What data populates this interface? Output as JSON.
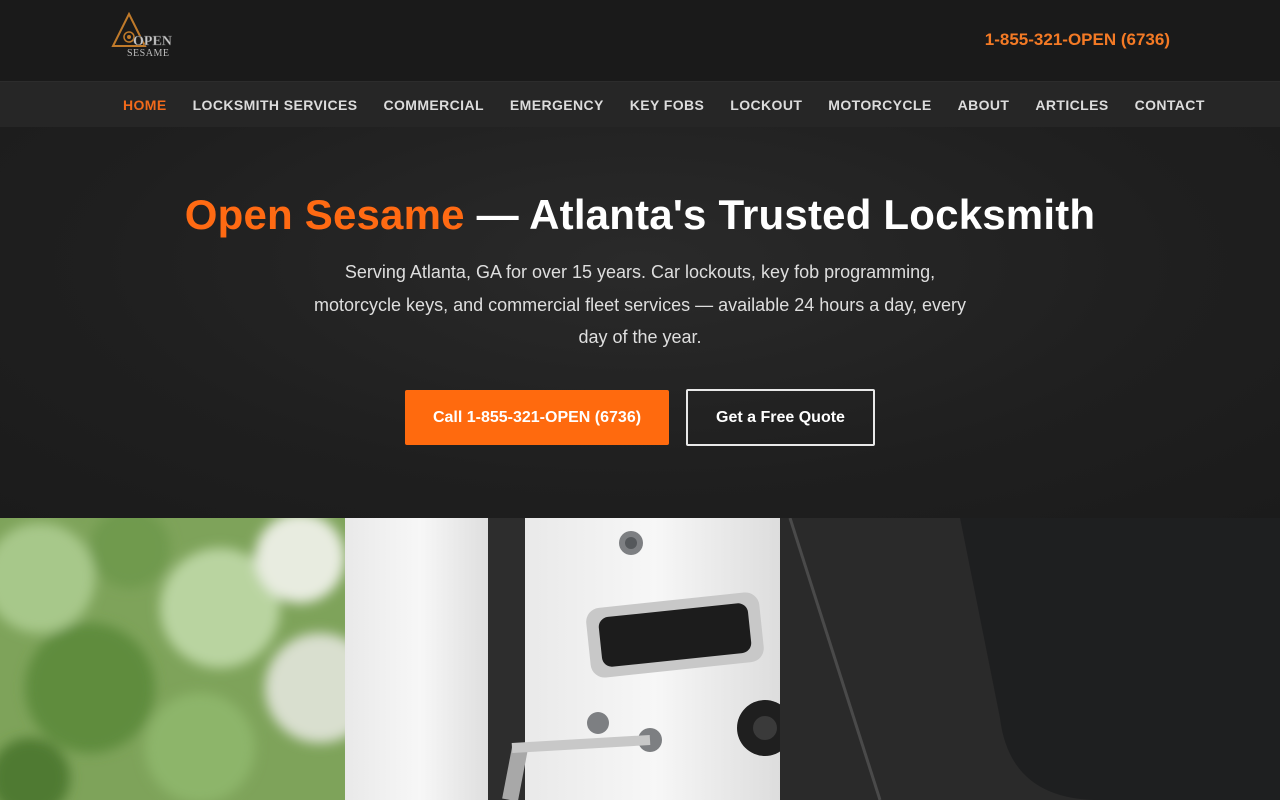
{
  "header": {
    "logo_text": "OPEN SESAME",
    "phone": "1-855-321-OPEN (6736)"
  },
  "nav": {
    "items": [
      {
        "label": "HOME",
        "active": true
      },
      {
        "label": "LOCKSMITH SERVICES"
      },
      {
        "label": "COMMERCIAL"
      },
      {
        "label": "EMERGENCY"
      },
      {
        "label": "KEY FOBS"
      },
      {
        "label": "LOCKOUT"
      },
      {
        "label": "MOTORCYCLE"
      },
      {
        "label": "ABOUT"
      },
      {
        "label": "ARTICLES"
      },
      {
        "label": "CONTACT"
      }
    ]
  },
  "hero": {
    "title_brand": "Open Sesame",
    "title_rest": " — Atlanta's Trusted Locksmith",
    "subtitle": "Serving Atlanta, GA for over 15 years. Car lockouts, key fob programming, motorcycle keys, and commercial fleet services — available 24 hours a day, every day of the year.",
    "call_button": "Call 1-855-321-OPEN (6736)",
    "quote_button": "Get a Free Quote"
  },
  "colors": {
    "accent": "#ff6a13",
    "background": "#1b1b1b",
    "nav_background": "#262626"
  }
}
